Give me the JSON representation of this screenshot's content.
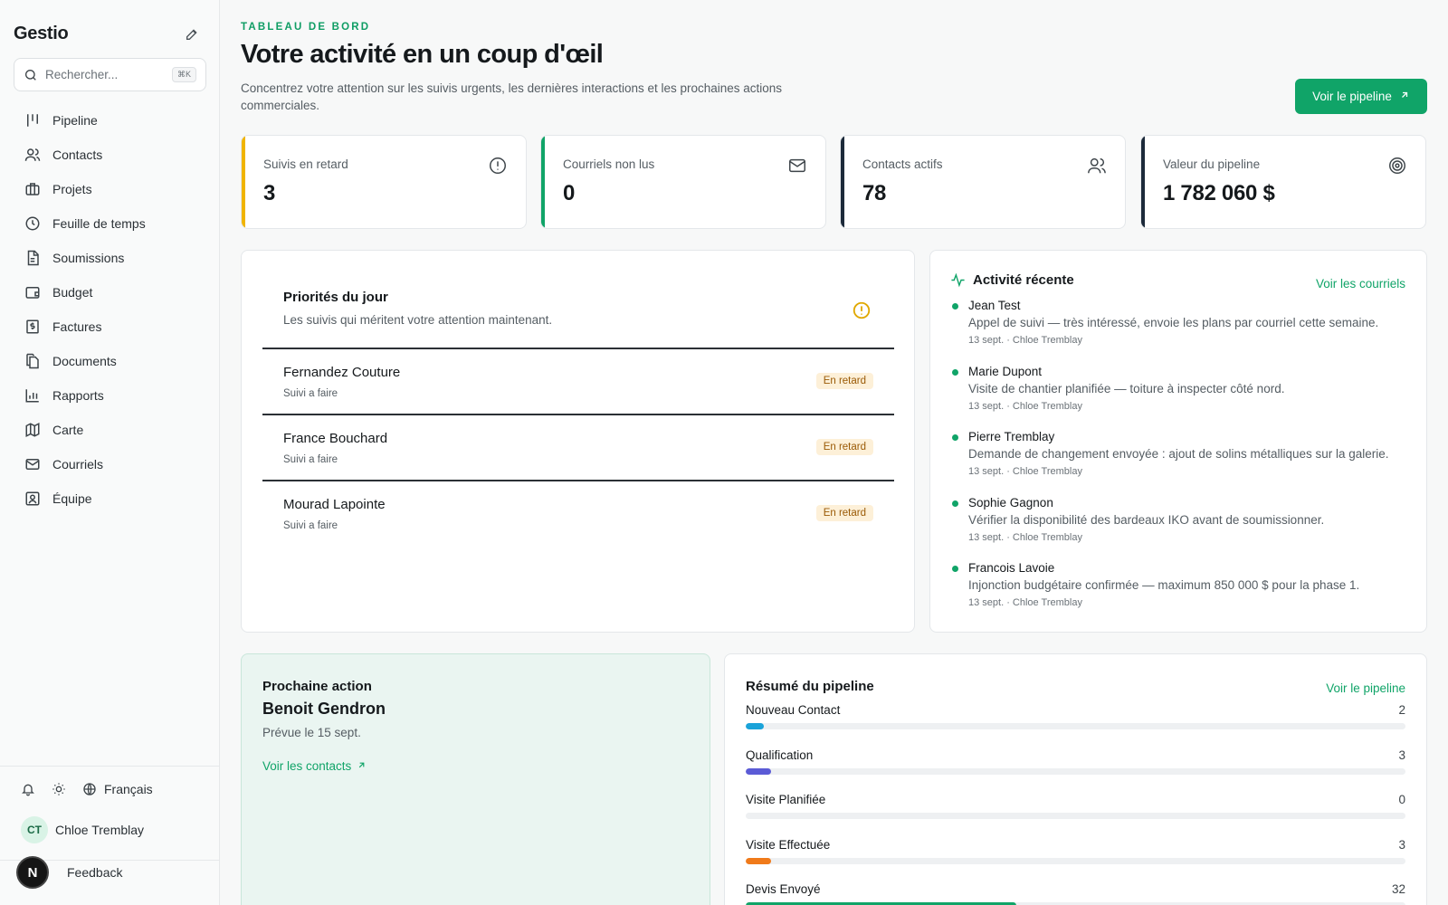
{
  "sidebar": {
    "brand": "Gestio",
    "search": {
      "placeholder": "Rechercher...",
      "shortcut": "⌘K"
    },
    "items": [
      {
        "label": "Pipeline",
        "icon": "pipeline-icon"
      },
      {
        "label": "Contacts",
        "icon": "users-icon"
      },
      {
        "label": "Projets",
        "icon": "briefcase-icon"
      },
      {
        "label": "Feuille de temps",
        "icon": "clock-icon"
      },
      {
        "label": "Soumissions",
        "icon": "document-icon"
      },
      {
        "label": "Budget",
        "icon": "wallet-icon"
      },
      {
        "label": "Factures",
        "icon": "invoice-icon"
      },
      {
        "label": "Documents",
        "icon": "files-icon"
      },
      {
        "label": "Rapports",
        "icon": "bar-chart-icon"
      },
      {
        "label": "Carte",
        "icon": "map-icon"
      },
      {
        "label": "Courriels",
        "icon": "mail-icon"
      },
      {
        "label": "Équipe",
        "icon": "team-icon"
      }
    ],
    "language": "Français",
    "user": {
      "initials": "CT",
      "name": "Chloe Tremblay"
    },
    "feedback": "Feedback",
    "badge": "N"
  },
  "header": {
    "eyebrow": "TABLEAU DE BORD",
    "title": "Votre activité en un coup d'œil",
    "subtitle": "Concentrez votre attention sur les suivis urgents, les dernières interactions et les prochaines actions commerciales.",
    "cta": "Voir le pipeline"
  },
  "kpis": [
    {
      "label": "Suivis en retard",
      "value": "3",
      "color": "#f0b400",
      "icon": "alert-circle-icon"
    },
    {
      "label": "Courriels non lus",
      "value": "0",
      "color": "#10a468",
      "icon": "mail-icon"
    },
    {
      "label": "Contacts actifs",
      "value": "78",
      "color": "#1c2a3a",
      "icon": "users-icon"
    },
    {
      "label": "Valeur du pipeline",
      "value": "1 782 060 $",
      "color": "#1c2a3a",
      "icon": "target-icon"
    }
  ],
  "priorities": {
    "title": "Priorités du jour",
    "subtitle": "Les suivis qui méritent votre attention maintenant.",
    "items": [
      {
        "name": "Fernandez Couture",
        "sub": "Suivi a faire",
        "status": "En retard"
      },
      {
        "name": "France Bouchard",
        "sub": "Suivi a faire",
        "status": "En retard"
      },
      {
        "name": "Mourad Lapointe",
        "sub": "Suivi a faire",
        "status": "En retard"
      }
    ]
  },
  "activity": {
    "title": "Activité récente",
    "link": "Voir les courriels",
    "items": [
      {
        "name": "Jean Test",
        "text": "Appel de suivi — très intéressé, envoie les plans par courriel cette semaine.",
        "meta": "13 sept. · Chloe Tremblay"
      },
      {
        "name": "Marie Dupont",
        "text": "Visite de chantier planifiée — toiture à inspecter côté nord.",
        "meta": "13 sept. · Chloe Tremblay"
      },
      {
        "name": "Pierre Tremblay",
        "text": "Demande de changement envoyée : ajout de solins métalliques sur la galerie.",
        "meta": "13 sept. · Chloe Tremblay"
      },
      {
        "name": "Sophie Gagnon",
        "text": "Vérifier la disponibilité des bardeaux IKO avant de soumissionner.",
        "meta": "13 sept. · Chloe Tremblay"
      },
      {
        "name": "Francois Lavoie",
        "text": "Injonction budgétaire confirmée — maximum 850 000 $ pour la phase 1.",
        "meta": "13 sept. · Chloe Tremblay"
      }
    ]
  },
  "next_action": {
    "label": "Prochaine action",
    "name": "Benoit Gendron",
    "date": "Prévue le 15 sept.",
    "link": "Voir les contacts"
  },
  "pipeline": {
    "title": "Résumé du pipeline",
    "link": "Voir le pipeline",
    "stages": [
      {
        "label": "Nouveau Contact",
        "value": "2",
        "fraction": 0.027,
        "color": "#1aa3d9"
      },
      {
        "label": "Qualification",
        "value": "3",
        "fraction": 0.038,
        "color": "#5b5bd6"
      },
      {
        "label": "Visite Planifiée",
        "value": "0",
        "fraction": 0,
        "color": "#8a8f94"
      },
      {
        "label": "Visite Effectuée",
        "value": "3",
        "fraction": 0.038,
        "color": "#f07a1a"
      },
      {
        "label": "Devis Envoyé",
        "value": "32",
        "fraction": 0.41,
        "color": "#10a468"
      }
    ]
  }
}
